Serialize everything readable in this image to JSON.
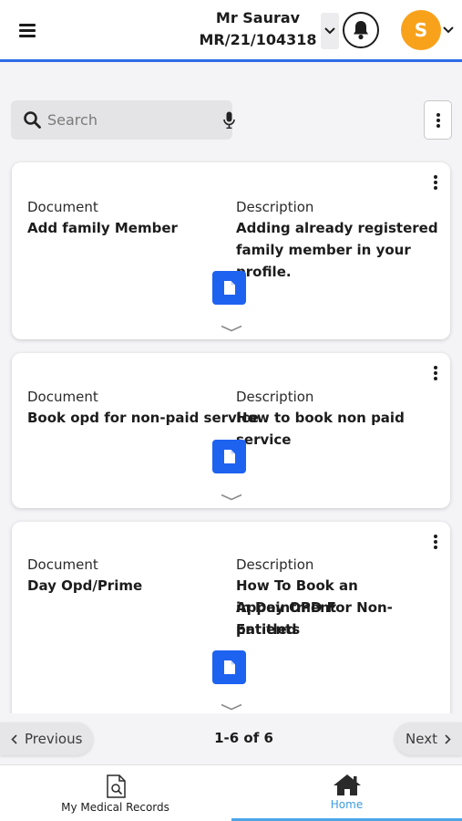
{
  "header": {
    "patient_name": "Mr Saurav",
    "patient_id": "MR/21/104318",
    "avatar_initial": "S"
  },
  "search": {
    "placeholder": "Search"
  },
  "cards": [
    {
      "doc_label": "Document",
      "doc_value": "Add family Member",
      "desc_label": "Description",
      "desc_lines": [
        "Adding already registered",
        "family member in your profile."
      ]
    },
    {
      "doc_label": "Document",
      "doc_value": "Book opd for non-paid service",
      "desc_label": "Description",
      "desc_lines": [
        "How to book non paid service"
      ]
    },
    {
      "doc_label": "Document",
      "doc_value": "Day Opd/Prime",
      "desc_label": "Description",
      "desc_lines": [
        "How To Book an Appointment",
        "in Day OPD For Non-Entitled",
        "patients"
      ]
    }
  ],
  "pagination": {
    "previous_label": "Previous",
    "count": "1-6 of 6",
    "next_label": "Next"
  },
  "bottom_nav": {
    "records_label": "My Medical Records",
    "home_label": "Home"
  },
  "colors": {
    "accent": "#2e6be6",
    "doc_button": "#1e62f0",
    "avatar": "#f8a21c",
    "home_active": "#3d9be0"
  },
  "icons": [
    "menu-icon",
    "chevron-down-icon",
    "bell-icon",
    "search-icon",
    "microphone-icon",
    "more-vertical-icon",
    "document-icon",
    "expand-chevron-icon",
    "chevron-left-icon",
    "chevron-right-icon",
    "medical-record-icon",
    "home-icon"
  ]
}
